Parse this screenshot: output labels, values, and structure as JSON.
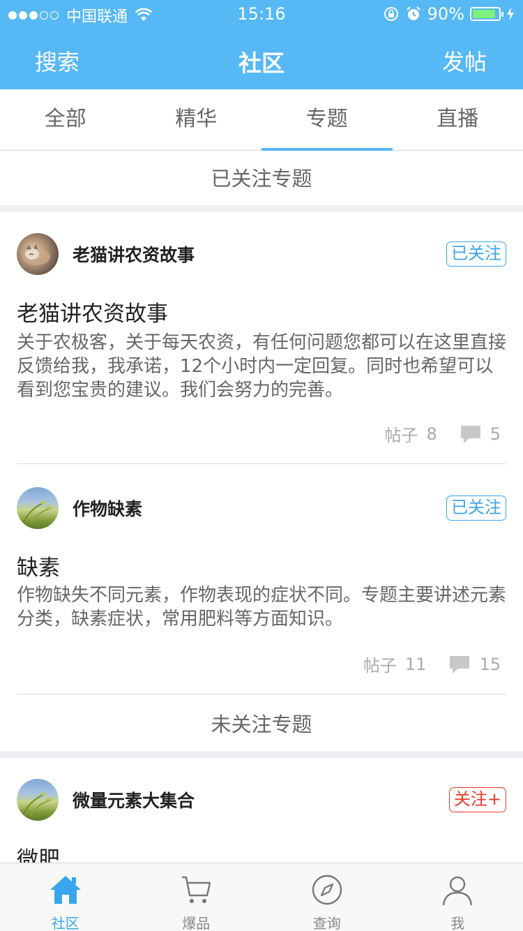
{
  "status_bar": {
    "carrier": "中国联通",
    "time": "15:16",
    "battery_percent": "90%",
    "battery_level": 0.9
  },
  "navbar": {
    "left": "搜索",
    "title": "社区",
    "right": "发帖"
  },
  "tabs": [
    {
      "label": "全部",
      "active": false
    },
    {
      "label": "精华",
      "active": false
    },
    {
      "label": "专题",
      "active": true
    },
    {
      "label": "直播",
      "active": false
    }
  ],
  "followed_section": "已关注专题",
  "unfollowed_section": "未关注专题",
  "cards": [
    {
      "name": "老猫讲农资故事",
      "follow_label": "已关注",
      "title": "老猫讲农资故事",
      "desc": "关于农极客，关于每天农资，有任何问题您都可以在这里直接反馈给我，我承诺，12个小时内一定回复。同时也希望可以看到您宝贵的建议。我们会努力的完善。",
      "posts_label": "帖子",
      "posts": "8",
      "comments": "5"
    },
    {
      "name": "作物缺素",
      "follow_label": "已关注",
      "title": "缺素",
      "desc": "作物缺失不同元素，作物表现的症状不同。专题主要讲述元素分类，缺素症状，常用肥料等方面知识。",
      "posts_label": "帖子",
      "posts": "11",
      "comments": "15"
    },
    {
      "name": "微量元素大集合",
      "follow_label": "关注+",
      "title": "微肥"
    }
  ],
  "tabbar": [
    {
      "label": "社区",
      "icon": "home-icon",
      "active": true
    },
    {
      "label": "爆品",
      "icon": "cart-icon",
      "active": false
    },
    {
      "label": "查询",
      "icon": "compass-icon",
      "active": false
    },
    {
      "label": "我",
      "icon": "person-icon",
      "active": false
    }
  ],
  "colors": {
    "brand": "#56b8f5",
    "follow_blue": "#3aa5ec",
    "follow_red": "#e8392a"
  }
}
